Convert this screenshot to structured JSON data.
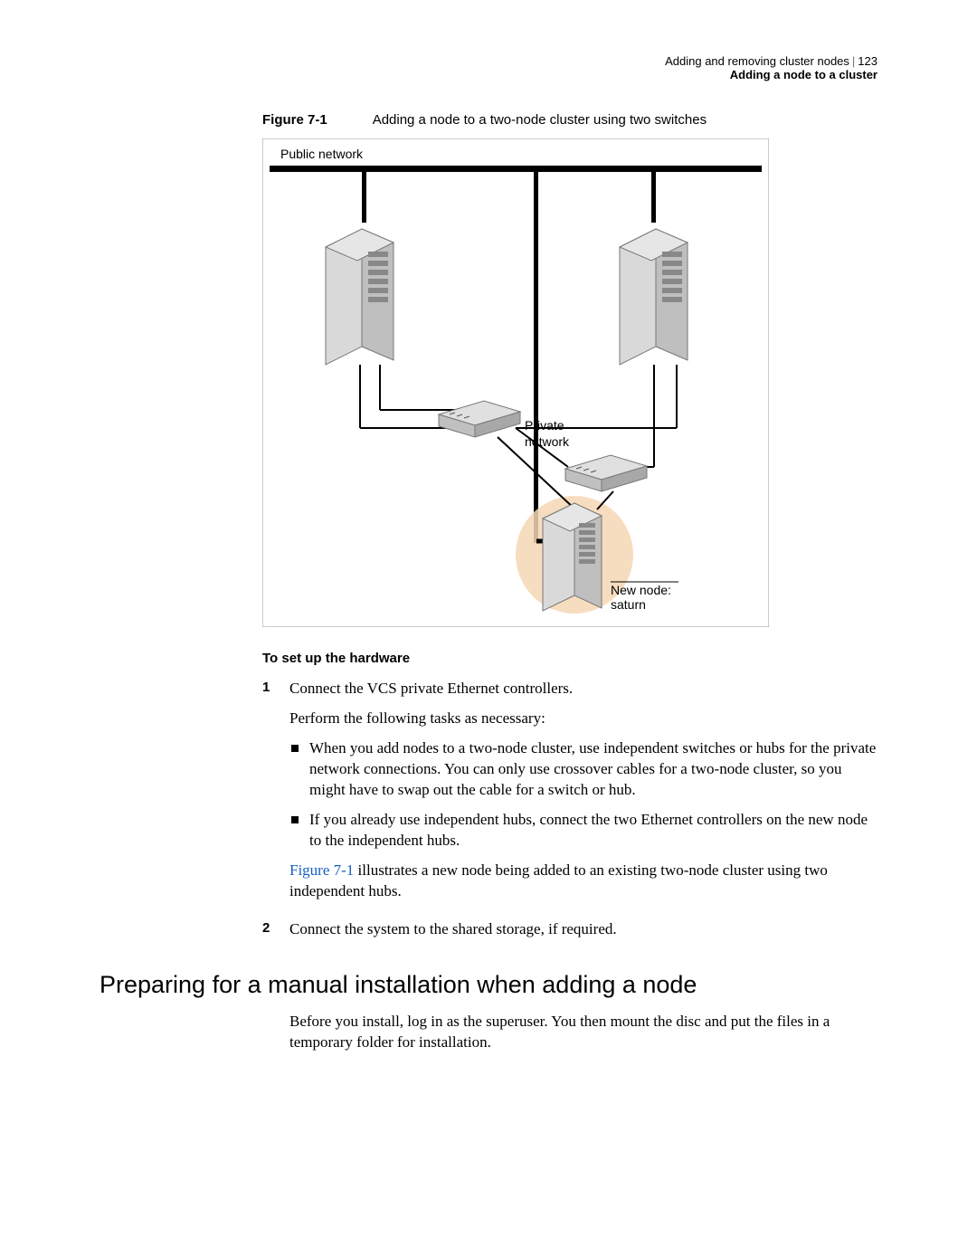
{
  "header": {
    "chapter": "Adding and removing cluster nodes",
    "section": "Adding a node to a cluster",
    "page": "123"
  },
  "figure": {
    "label": "Figure 7-1",
    "caption": "Adding a node to a two-node cluster using two switches",
    "labels": {
      "public_network": "Public network",
      "private_network_l1": "Private",
      "private_network_l2": "network",
      "new_node_l1": "New node:",
      "new_node_l2": "saturn"
    }
  },
  "hardware_heading": "To set up the hardware",
  "steps": [
    {
      "num": "1",
      "text": "Connect the VCS private Ethernet controllers.",
      "sub": "Perform the following tasks as necessary:",
      "bullets": [
        "When you add nodes to a two-node cluster, use independent switches or hubs for the private network connections. You can only use crossover cables for a two-node cluster, so you might have to swap out the cable for a switch or hub.",
        "If you already use independent hubs, connect the two Ethernet controllers on the new node to the independent hubs."
      ],
      "after_link": "Figure 7-1",
      "after_text": " illustrates a new node being added to an existing two-node cluster using two independent hubs."
    },
    {
      "num": "2",
      "text": "Connect the system to the shared storage, if required."
    }
  ],
  "section": {
    "heading": "Preparing for a manual installation when adding a node",
    "body": "Before you install, log in as the superuser. You then mount the disc and put the files in a temporary folder for installation."
  }
}
